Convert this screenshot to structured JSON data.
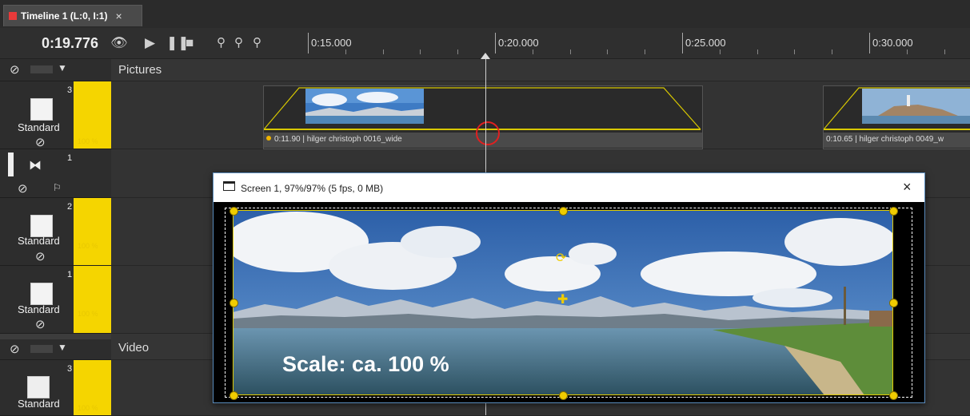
{
  "tab": {
    "title": "Timeline 1 (L:0, I:1)",
    "close": "×"
  },
  "toolbar": {
    "time": "0:19.776",
    "ruler_labels": [
      "0:15.000",
      "0:20.000",
      "0:25.000",
      "0:30.000"
    ]
  },
  "sections": {
    "pictures": "Pictures",
    "video": "Video"
  },
  "tracks": [
    {
      "number": "3",
      "label": "Standard",
      "opacity": "100 %"
    },
    {
      "number": "1"
    },
    {
      "number": "2",
      "label": "Standard",
      "opacity": "100 %"
    },
    {
      "number": "1",
      "label": "Standard",
      "opacity": "100 %"
    },
    {
      "number": "3",
      "label": "Standard",
      "opacity": "100 %"
    }
  ],
  "clips": [
    {
      "label": "0:11.90 | hilger christoph 0016_wide"
    },
    {
      "label": "0:10.65 | hilger christoph 0049_w"
    }
  ],
  "preview": {
    "title": "Screen 1, 97%/97% (5 fps, 0 MB)",
    "close": "×",
    "caption": "Scale: ca. 100 %"
  },
  "colors": {
    "accent_yellow": "#f5d500",
    "clip_marker_ring": "#e02020",
    "window_border": "#5b8dbe"
  }
}
